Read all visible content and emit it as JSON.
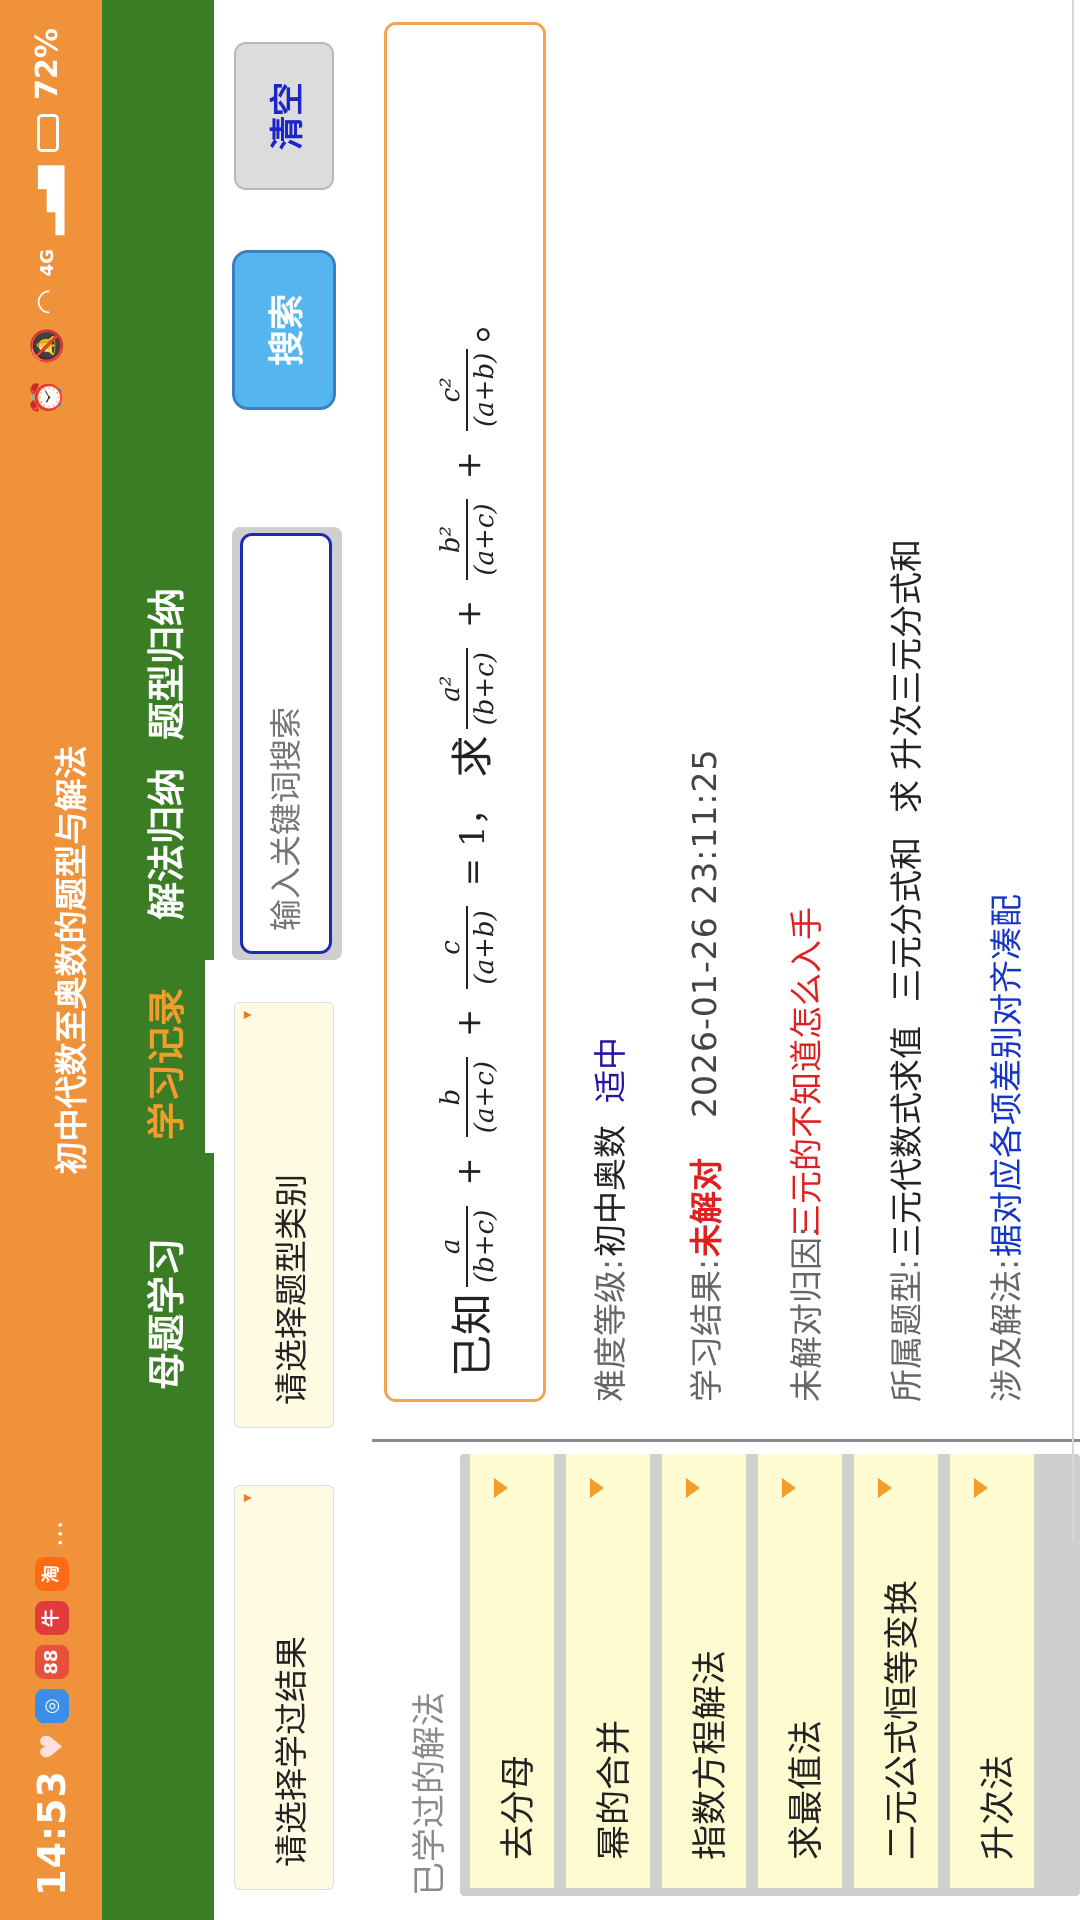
{
  "status_bar": {
    "time": "14:53",
    "battery": "72%",
    "network_label": "4G",
    "app_icons": [
      "heart-icon",
      "browser-icon",
      "88-app-icon",
      "cow-app-icon",
      "taobao-icon"
    ],
    "more": "..."
  },
  "app": {
    "title": "初中代数至奥数的题型与解法"
  },
  "nav": {
    "tabs": [
      {
        "label": "母题学习"
      },
      {
        "label": "学习记录"
      },
      {
        "label": "解法归纳"
      },
      {
        "label": "题型归纳"
      }
    ],
    "active_index": 1
  },
  "filters": {
    "result_select": "请选择学过结果",
    "type_select": "请选择题型类别",
    "keyword_placeholder": "输入关键词搜索",
    "search_label": "搜索",
    "clear_label": "清空"
  },
  "left_panel": {
    "title": "已学过的解法",
    "methods": [
      "去分母",
      "幂的合并",
      "指数方程解法",
      "求最值法",
      "二元公式恒等变换",
      "升次法"
    ]
  },
  "record": {
    "problem": {
      "prefix": "已知",
      "t1": {
        "num": "a",
        "den": "(b+c)"
      },
      "t2": {
        "num": "b",
        "den": "(a+c)"
      },
      "t3": {
        "num": "c",
        "den": "(a+b)"
      },
      "eq": "= 1，",
      "ask": "求",
      "q1": {
        "num": "a²",
        "den": "(b+c)"
      },
      "q2": {
        "num": "b²",
        "den": "(a+c)"
      },
      "q3": {
        "num": "c²",
        "den": "(a+b)"
      },
      "end": "。"
    },
    "difficulty_label": "难度等级:",
    "difficulty_value": "初中奥数",
    "difficulty_tag": "适中",
    "result_label": "学习结果:",
    "result_value": "未解对",
    "date": "2026-01-26 23:11:25",
    "reason_label": "未解对归因:",
    "reason_value": "三元的不知道怎么入手",
    "type_label": "所属题型:",
    "types": [
      "三元代数式求值",
      "三元分式和",
      "求",
      "升次三元分式和"
    ],
    "method_label": "涉及解法:",
    "method_value": "据对应各项差别对齐凑配"
  },
  "colors": {
    "status_bar": "#f0923a",
    "nav_bar": "#3a7d24",
    "active_tab": "#f39c2e",
    "accent_red": "#e02020",
    "accent_blue": "#1535c8",
    "search_button": "#55b6ef"
  }
}
